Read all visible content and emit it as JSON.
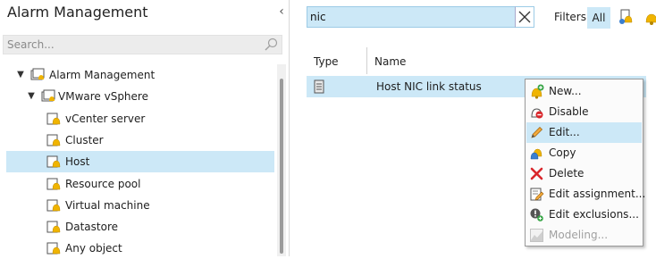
{
  "left_panel": {
    "title": "Alarm Management",
    "collapse_glyph": "‹",
    "search_placeholder": "Search...",
    "tree": [
      {
        "label": "Alarm Management",
        "expanded": true,
        "icon": "alarm-folder-icon"
      },
      {
        "label": "VMware vSphere",
        "expanded": true,
        "icon": "alarm-folder-icon"
      },
      {
        "label": "vCenter server",
        "icon": "alarm-bell-icon"
      },
      {
        "label": "Cluster",
        "icon": "alarm-bell-icon"
      },
      {
        "label": "Host",
        "icon": "alarm-bell-icon",
        "selected": true
      },
      {
        "label": "Resource pool",
        "icon": "alarm-bell-icon"
      },
      {
        "label": "Virtual machine",
        "icon": "alarm-bell-icon"
      },
      {
        "label": "Datastore",
        "icon": "alarm-bell-icon"
      },
      {
        "label": "Any object",
        "icon": "alarm-bell-icon"
      }
    ]
  },
  "right_panel": {
    "filter_value": "nic",
    "filters_label": "Filters:",
    "filter_all_label": "All",
    "columns": {
      "type": "Type",
      "name": "Name"
    },
    "rows": [
      {
        "type_icon": "host-server-icon",
        "name": "Host NIC link status",
        "selected": true
      }
    ]
  },
  "context_menu": {
    "items": [
      {
        "label": "New...",
        "icon": "new-alarm-icon",
        "enabled": true
      },
      {
        "label": "Disable",
        "icon": "disable-alarm-icon",
        "enabled": true
      },
      {
        "label": "Edit...",
        "icon": "pencil-icon",
        "enabled": true,
        "highlighted": true
      },
      {
        "label": "Copy",
        "icon": "copy-alarm-icon",
        "enabled": true
      },
      {
        "label": "Delete",
        "icon": "delete-x-icon",
        "enabled": true
      },
      {
        "label": "Edit assignment...",
        "icon": "edit-assignment-icon",
        "enabled": true
      },
      {
        "label": "Edit exclusions...",
        "icon": "exclusion-icon",
        "enabled": true
      },
      {
        "label": "Modeling...",
        "icon": "modeling-chart-icon",
        "enabled": false
      }
    ]
  },
  "colors": {
    "selection": "#cce8f7",
    "accent_border": "#9ccbe6",
    "bell_yellow": "#f0b400",
    "delete_red": "#d9262b",
    "new_green": "#37a546"
  }
}
